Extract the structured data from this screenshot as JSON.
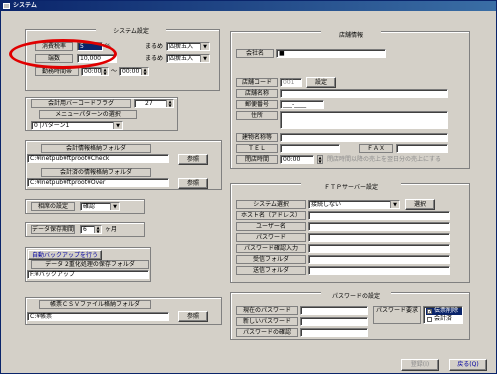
{
  "window": {
    "title": "システム"
  },
  "system": {
    "header": "システム設定",
    "tax_label": "消費税率",
    "tax_value": "5",
    "tax_unit": "%",
    "round_label": "まるめ",
    "round_value": "四捨五入",
    "rounding2_label": "端数",
    "rounding2_value": "10,000",
    "round2_label": "まるめ",
    "round2_value": "四捨五入",
    "worktime_label": "勤務時間帯",
    "worktime_from": "00:00",
    "worktime_sep": "～",
    "worktime_to": "00:00"
  },
  "barcode": {
    "flag_label": "会計用バーコードフラグ",
    "flag_value": "27",
    "menu_pattern_label": "メニューパターンの選択",
    "menu_pattern_value": "0 |パターン1"
  },
  "accounting": {
    "folder_label": "会計情報格納フォルダ",
    "folder_value": "C:¥Inetpub¥ftproot¥Check",
    "done_folder_label": "会計済の情報格納フォルダ",
    "done_folder_value": "C:¥Inetpub¥ftproot¥Over",
    "browse1": "参照",
    "browse2": "参照"
  },
  "misc": {
    "reserve_label": "相席の設定",
    "reserve_value": "確認",
    "retention_label": "データ保存期間",
    "retention_value": "6",
    "retention_unit": "ヶ月"
  },
  "backup": {
    "auto_button": "自動バックアップを行う",
    "folder_label": "データ 2重化処理の保存フォルダ",
    "folder_value": "F:¥バックアップ"
  },
  "csv": {
    "folder_label": "帳票ＣＳＶファイル格納フォルダ",
    "folder_value": "C:¥帳票",
    "browse": "参照"
  },
  "store": {
    "header": "店舗情報",
    "company_label": "会社名",
    "company_value": "■",
    "code_label": "店舗コード",
    "code_value": "001",
    "settings_button": "設定",
    "name_label": "店舗名称",
    "zip_label": "郵便番号",
    "zip_value": "___-____",
    "address_label": "住所",
    "building_label": "建物名称等",
    "tel_label": "ＴＥＬ",
    "fax_label": "ＦＡＸ",
    "hours_label": "閉店時間",
    "hours_value": "00:00",
    "hours_note": "閉店時間以降の売上を翌日分の売上にする"
  },
  "ftp": {
    "header": "ＦＴＰサーバー設定",
    "system_label": "システム選択",
    "system_value": "接続しない",
    "select_button": "選択",
    "host_label": "ホスト名（アドレス）",
    "user_label": "ユーザー名",
    "password_label": "パスワード",
    "password_confirm_label": "パスワード確認入力",
    "recv_label": "受信フォルダ",
    "send_label": "送信フォルダ"
  },
  "password": {
    "header": "パスワードの設定",
    "current_label": "現在のパスワード",
    "new_label": "新しいパスワード",
    "confirm_label": "パスワードの確認",
    "required_label": "パスワード要求",
    "opt_delete": "伝票削除",
    "opt_accounting": "会計済"
  },
  "footer": {
    "register_button": "登録(I)",
    "back_button": "戻る(Q)"
  }
}
